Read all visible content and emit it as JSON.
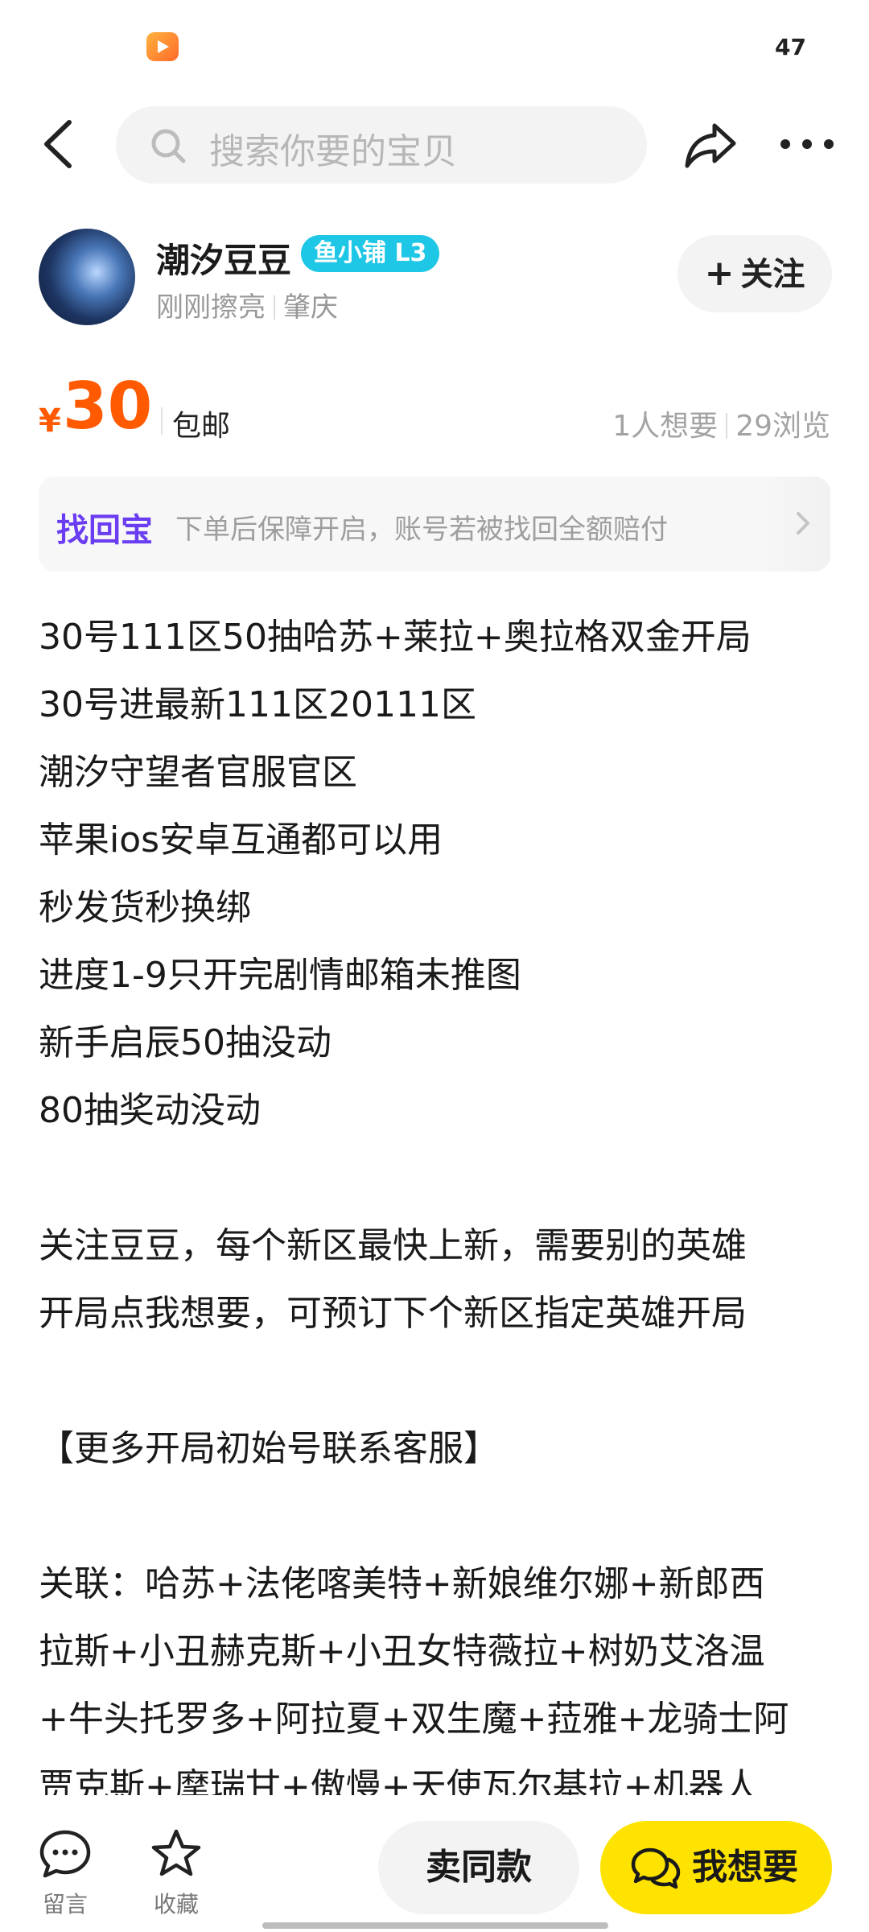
{
  "status_bar": {
    "app_icon": "play-app-icon",
    "number": "47"
  },
  "nav": {
    "search_placeholder": "搜索你要的宝贝"
  },
  "seller": {
    "name": "潮汐豆豆",
    "badge": "鱼小铺 L3",
    "active_text": "刚刚擦亮",
    "location": "肇庆",
    "follow_label": "关注"
  },
  "price": {
    "currency": "¥",
    "value": "30",
    "shipping": "包邮",
    "wants": "1人想要",
    "views": "29浏览"
  },
  "guarantee": {
    "tag": "找回宝",
    "text": "下单后保障开启，账号若被找回全额赔付"
  },
  "description": [
    "30号111区50抽哈苏+莱拉+奥拉格双金开局",
    "30号进最新111区20111区",
    "潮汐守望者官服官区",
    "苹果ios安卓互通都可以用",
    "秒发货秒换绑",
    "进度1-9只开完剧情邮箱未推图",
    "新手启辰50抽没动",
    "80抽奖动没动",
    "",
    "关注豆豆，每个新区最快上新，需要别的英雄",
    "开局点我想要，可预订下个新区指定英雄开局",
    "",
    "【更多开局初始号联系客服】",
    "",
    "关联：哈苏+法佬喀美特+新娘维尔娜+新郎西",
    "拉斯+小丑赫克斯+小丑女特薇拉+树奶艾洛温",
    "+牛头托罗多+阿拉夏+双生魔+菈雅+龙骑士阿",
    "贾克斯+摩瑞甘+傲慢+天使瓦尔基拉+机器人"
  ],
  "bottom_bar": {
    "comment_label": "留言",
    "favorite_label": "收藏",
    "sell_same_label": "卖同款",
    "want_label": "我想要"
  },
  "colors": {
    "price": "#ff5a00",
    "want_button": "#ffe300",
    "guarantee_tag": "#6a3df2",
    "badge": "#1ec7e6"
  }
}
